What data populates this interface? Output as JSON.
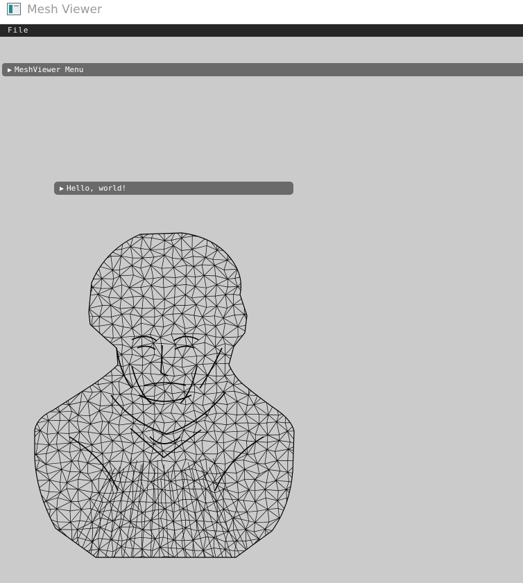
{
  "window": {
    "title": "Mesh Viewer",
    "icon": "app-window-icon"
  },
  "menubar": {
    "items": [
      {
        "label": "File"
      }
    ]
  },
  "panels": {
    "main": {
      "label": "MeshViewer Menu",
      "collapsed": true,
      "icon": "collapse-arrow-icon"
    },
    "hello": {
      "label": "Hello, world!",
      "collapsed": true,
      "icon": "collapse-arrow-icon"
    }
  },
  "colors": {
    "background": "#cbcbcb",
    "menubar": "#262626",
    "panel_header": "#6a6a6a",
    "wireframe": "#000000"
  }
}
